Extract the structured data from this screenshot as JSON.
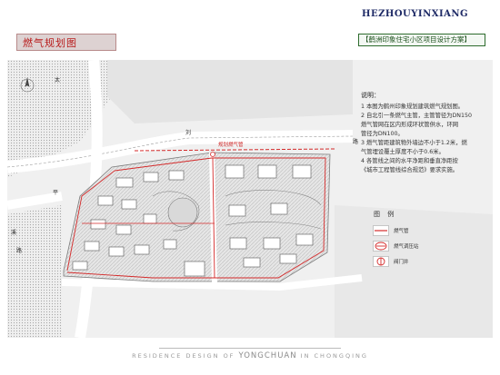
{
  "header": {
    "title": "燃气规划图",
    "brand": "HEZHOUYINXIANG",
    "project": "【鹤洲印象住宅小区项目设计方案】"
  },
  "notes": {
    "heading": "说明：",
    "lines": [
      "1 本图为鹤州印象规划建筑燃气规划图。",
      "2 自北引一条燃气主管，主管管径为DN150",
      "  燃气管网在区内形成环状管供水，环网",
      "  管径为DN100。",
      "3 燃气管距建筑物外墙边不小于1.2米，燃",
      "  气管埋设覆土厚度不小于0.6米。",
      "4 各管线之间的水平净距和垂直净距按",
      "  《城市工程管线综合规范》要求实施。"
    ]
  },
  "legend": {
    "title": "图  例",
    "items": [
      {
        "label": "燃气管",
        "symbol": "gas-pipe"
      },
      {
        "label": "燃气调压站",
        "symbol": "regulator-station"
      },
      {
        "label": "阀门井",
        "symbol": "valve-well"
      }
    ]
  },
  "map": {
    "road_labels": [
      "太",
      "刘",
      "路",
      "平",
      "溪",
      "路"
    ],
    "gas_main_label": "规划燃气管"
  },
  "footer": {
    "pre": "RESIDENCE DESIGN OF",
    "main": "YONGCHUAN",
    "post": "IN CHONGQING"
  },
  "colors": {
    "title_red": "#b81d1d",
    "brand_blue": "#1e2a66",
    "project_green": "#1b4f1b",
    "gas_pipe": "#d42a2a"
  }
}
